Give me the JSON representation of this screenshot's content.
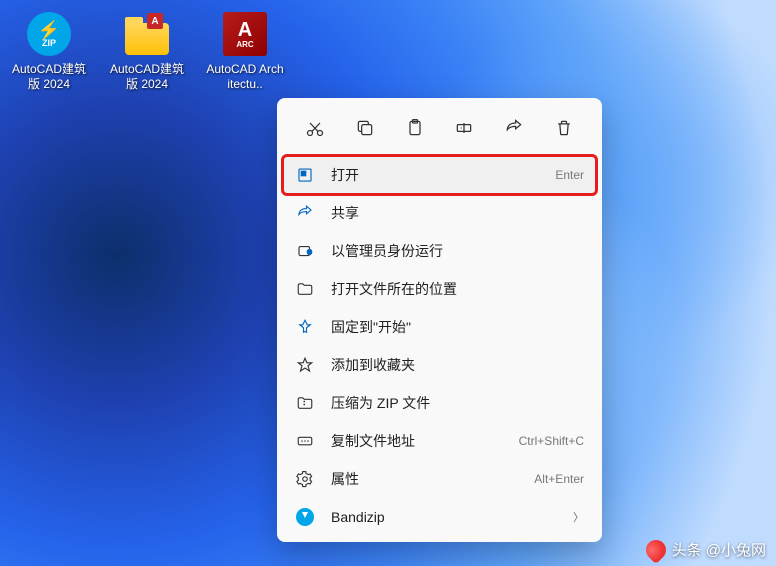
{
  "desktop": {
    "icons": [
      {
        "label": "AutoCAD建筑版 2024",
        "type": "zip",
        "zip_text": "ZIP"
      },
      {
        "label": "AutoCAD建筑版 2024",
        "type": "folder",
        "badge": "A"
      },
      {
        "label": "AutoCAD Architectu..",
        "type": "arc",
        "arc_a": "A",
        "arc_text": "ARC"
      }
    ]
  },
  "context_menu": {
    "top_actions": [
      "cut",
      "copy",
      "paste",
      "rename",
      "share",
      "delete"
    ],
    "items": [
      {
        "icon": "open",
        "label": "打开",
        "shortcut": "Enter",
        "highlighted": true
      },
      {
        "icon": "share",
        "label": "共享",
        "shortcut": ""
      },
      {
        "icon": "admin",
        "label": "以管理员身份运行",
        "shortcut": ""
      },
      {
        "icon": "folder",
        "label": "打开文件所在的位置",
        "shortcut": ""
      },
      {
        "icon": "pin",
        "label": "固定到\"开始\"",
        "shortcut": ""
      },
      {
        "icon": "star",
        "label": "添加到收藏夹",
        "shortcut": ""
      },
      {
        "icon": "zip",
        "label": "压缩为 ZIP 文件",
        "shortcut": ""
      },
      {
        "icon": "path",
        "label": "复制文件地址",
        "shortcut": "Ctrl+Shift+C"
      },
      {
        "icon": "properties",
        "label": "属性",
        "shortcut": "Alt+Enter"
      },
      {
        "icon": "bandizip",
        "label": "Bandizip",
        "shortcut": "",
        "submenu": true
      }
    ]
  },
  "watermark": {
    "text": "头条 @小兔网"
  }
}
